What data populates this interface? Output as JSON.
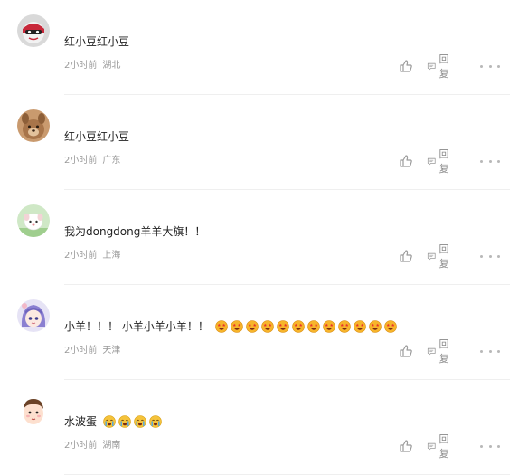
{
  "reply_label": "回复",
  "comments": [
    {
      "avatar": "red-mask-avatar",
      "user": "红小豆红小豆",
      "text": "红小豆红小豆",
      "emojis": [],
      "time": "2小时前",
      "location": "湖北"
    },
    {
      "avatar": "brown-animal-avatar",
      "user": "红小豆红小豆",
      "text": "红小豆红小豆",
      "emojis": [],
      "time": "2小时前",
      "location": "广东"
    },
    {
      "avatar": "white-dog-avatar",
      "text": "我为dongdong羊羊大旗！！",
      "emojis": [],
      "time": "2小时前",
      "location": "上海"
    },
    {
      "avatar": "anime-girl-avatar",
      "text": "小羊！！！ 小羊小羊小羊！！",
      "emojis": [
        "star-struck-emoji",
        "star-struck-emoji",
        "star-struck-emoji",
        "star-struck-emoji",
        "star-struck-emoji",
        "star-struck-emoji",
        "star-struck-emoji",
        "star-struck-emoji",
        "star-struck-emoji",
        "star-struck-emoji",
        "star-struck-emoji",
        "star-struck-emoji"
      ],
      "time": "2小时前",
      "location": "天津"
    },
    {
      "avatar": "cartoon-boy-avatar",
      "text": "水波蛋",
      "emojis": [
        "crying-emoji",
        "crying-emoji",
        "crying-emoji",
        "crying-emoji"
      ],
      "time": "2小时前",
      "location": "湖南"
    }
  ]
}
